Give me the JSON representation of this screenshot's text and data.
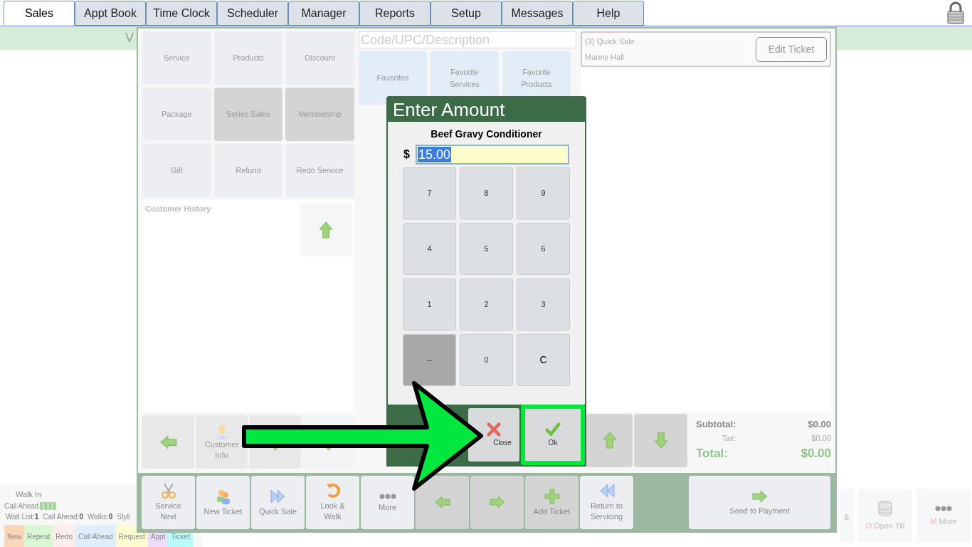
{
  "tabs": [
    {
      "label": "Sales",
      "selected": true
    },
    {
      "label": "Appt Book",
      "selected": false
    },
    {
      "label": "Time Clock",
      "selected": false
    },
    {
      "label": "Scheduler",
      "selected": false
    },
    {
      "label": "Manager",
      "selected": false
    },
    {
      "label": "Reports",
      "selected": false
    },
    {
      "label": "Setup",
      "selected": false
    },
    {
      "label": "Messages",
      "selected": false
    },
    {
      "label": "Help",
      "selected": false
    }
  ],
  "banner_text": "V",
  "waitlist": {
    "walk_in": "Walk In",
    "call_ahead": "Call Ahead",
    "stats": [
      {
        "label": "Wait List:",
        "value": "1"
      },
      {
        "label": "Call Ahead:",
        "value": "0"
      },
      {
        "label": "Walks:",
        "value": "0"
      },
      {
        "label": "Styli"
      }
    ],
    "legend": [
      {
        "label": "New",
        "color": "#fbd6b8"
      },
      {
        "label": "Repeat",
        "color": "#d8f7d2"
      },
      {
        "label": "Redo",
        "color": "#fdecec"
      },
      {
        "label": "Call Ahead",
        "color": "#dfeefd"
      },
      {
        "label": "Request",
        "color": "#fdfcd0"
      },
      {
        "label": "Appt",
        "color": "#eedcfb"
      },
      {
        "label": "Ticket",
        "color": "#b9fbfb"
      }
    ]
  },
  "bottom_right": [
    {
      "label": "&"
    },
    {
      "hotkey": "O",
      "label": "Open Till",
      "kind": "till"
    },
    {
      "hotkey": "M",
      "label": "More",
      "kind": "more"
    }
  ],
  "categories": [
    {
      "label": "Service",
      "highlighted": false
    },
    {
      "label": "Products",
      "highlighted": false
    },
    {
      "label": "Discount",
      "highlighted": false
    },
    {
      "label": "Package",
      "highlighted": false
    },
    {
      "label": "Series Sales",
      "highlighted": true
    },
    {
      "label": "Membership",
      "highlighted": true
    },
    {
      "label": "Gift",
      "highlighted": false
    },
    {
      "label": "Refund",
      "highlighted": false
    },
    {
      "label": "Redo Service",
      "highlighted": false
    }
  ],
  "customer_history": {
    "title": "Customer History"
  },
  "left_nav": [
    {
      "kind": "left"
    },
    {
      "kind": "customer",
      "label": "Customer Info"
    },
    {
      "kind": "down"
    },
    {
      "kind": "down"
    }
  ],
  "search": {
    "placeholder": "Code/UPC/Description"
  },
  "favorites": [
    "Favorites",
    "Favorite Services",
    "Favorite Products"
  ],
  "ticket": {
    "title": "(3) Quick Sale",
    "customer": "Manny Hall",
    "button": "Edit Ticket"
  },
  "totals": {
    "subtotal_label": "Subtotal:",
    "subtotal": "$0.00",
    "tax_label": "Tax:",
    "tax": "$0.00",
    "total_label": "Total:",
    "total": "$0.00"
  },
  "toolbar": [
    {
      "kind": "scissors",
      "label": "Service Next"
    },
    {
      "kind": "people",
      "label": "New Ticket"
    },
    {
      "kind": "forward",
      "label": "Quick Sale"
    },
    {
      "kind": "curve",
      "label": "Look & Walk"
    },
    {
      "kind": "dots",
      "label": "More"
    },
    {
      "kind": "left"
    },
    {
      "kind": "right"
    },
    {
      "kind": "plus",
      "label": "Add Ticket"
    },
    {
      "kind": "rewind",
      "label": "Return to Servicing"
    }
  ],
  "send_button": "Send to Payment",
  "dialog": {
    "title": "Enter Amount",
    "item": "Beef Gravy Conditioner",
    "currency": "$",
    "value": "15.00",
    "keys": [
      "7",
      "8",
      "9",
      "4",
      "5",
      "6",
      "1",
      "2",
      "3",
      "–",
      "0",
      "C"
    ],
    "buttons": [
      {
        "kind": "close",
        "label": "Close",
        "highlighted": false
      },
      {
        "kind": "ok",
        "label": "Ok",
        "highlighted": true
      }
    ]
  }
}
